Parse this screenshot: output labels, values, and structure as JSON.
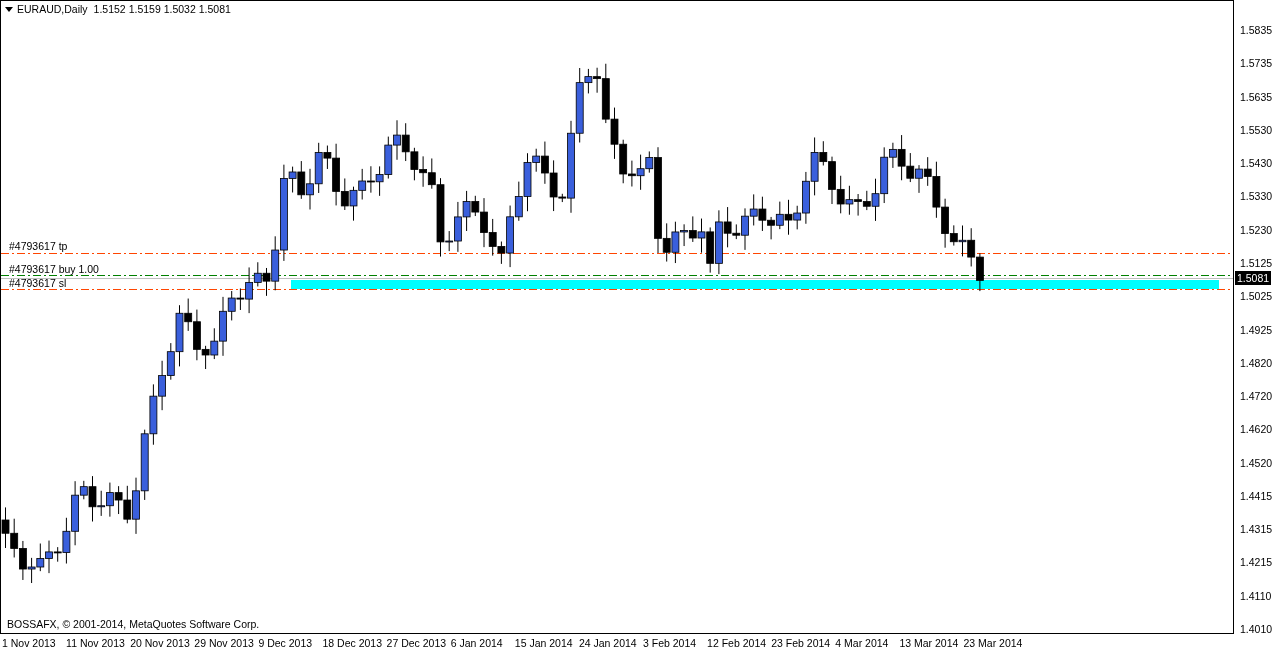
{
  "chart_header": {
    "symbol": "EURAUD,Daily",
    "ohlc": "1.5152 1.5159 1.5032 1.5081"
  },
  "order_lines": [
    {
      "kind": "tp",
      "label": "#4793617 tp"
    },
    {
      "kind": "buy",
      "label": "#4793617 buy 1.00"
    },
    {
      "kind": "sl",
      "label": "#4793617 sl"
    }
  ],
  "current_price": "1.5081",
  "price_scale": [
    "1.5835",
    "1.5735",
    "1.5635",
    "1.5530",
    "1.5430",
    "1.5330",
    "1.5230",
    "1.5125",
    "1.5025",
    "1.4925",
    "1.4820",
    "1.4720",
    "1.4620",
    "1.4520",
    "1.4415",
    "1.4315",
    "1.4215",
    "1.4110",
    "1.4010"
  ],
  "time_scale": [
    "1 Nov 2013",
    "11 Nov 2013",
    "20 Nov 2013",
    "29 Nov 2013",
    "9 Dec 2013",
    "18 Dec 2013",
    "27 Dec 2013",
    "6 Jan 2014",
    "15 Jan 2014",
    "24 Jan 2014",
    "3 Feb 2014",
    "12 Feb 2014",
    "23 Feb 2014",
    "4 Mar 2014",
    "13 Mar 2014",
    "23 Mar 2014"
  ],
  "copyright": "BOSSAFX, © 2001-2014, MetaQuotes Software Corp."
}
